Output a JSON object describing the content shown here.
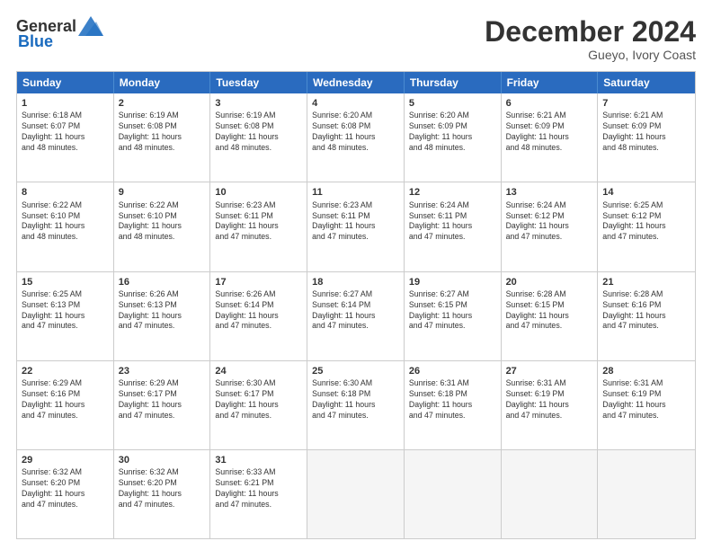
{
  "header": {
    "logo_general": "General",
    "logo_blue": "Blue",
    "month_title": "December 2024",
    "location": "Gueyo, Ivory Coast"
  },
  "days_of_week": [
    "Sunday",
    "Monday",
    "Tuesday",
    "Wednesday",
    "Thursday",
    "Friday",
    "Saturday"
  ],
  "weeks": [
    [
      {
        "day": "1",
        "lines": [
          "Sunrise: 6:18 AM",
          "Sunset: 6:07 PM",
          "Daylight: 11 hours",
          "and 48 minutes."
        ]
      },
      {
        "day": "2",
        "lines": [
          "Sunrise: 6:19 AM",
          "Sunset: 6:08 PM",
          "Daylight: 11 hours",
          "and 48 minutes."
        ]
      },
      {
        "day": "3",
        "lines": [
          "Sunrise: 6:19 AM",
          "Sunset: 6:08 PM",
          "Daylight: 11 hours",
          "and 48 minutes."
        ]
      },
      {
        "day": "4",
        "lines": [
          "Sunrise: 6:20 AM",
          "Sunset: 6:08 PM",
          "Daylight: 11 hours",
          "and 48 minutes."
        ]
      },
      {
        "day": "5",
        "lines": [
          "Sunrise: 6:20 AM",
          "Sunset: 6:09 PM",
          "Daylight: 11 hours",
          "and 48 minutes."
        ]
      },
      {
        "day": "6",
        "lines": [
          "Sunrise: 6:21 AM",
          "Sunset: 6:09 PM",
          "Daylight: 11 hours",
          "and 48 minutes."
        ]
      },
      {
        "day": "7",
        "lines": [
          "Sunrise: 6:21 AM",
          "Sunset: 6:09 PM",
          "Daylight: 11 hours",
          "and 48 minutes."
        ]
      }
    ],
    [
      {
        "day": "8",
        "lines": [
          "Sunrise: 6:22 AM",
          "Sunset: 6:10 PM",
          "Daylight: 11 hours",
          "and 48 minutes."
        ]
      },
      {
        "day": "9",
        "lines": [
          "Sunrise: 6:22 AM",
          "Sunset: 6:10 PM",
          "Daylight: 11 hours",
          "and 48 minutes."
        ]
      },
      {
        "day": "10",
        "lines": [
          "Sunrise: 6:23 AM",
          "Sunset: 6:11 PM",
          "Daylight: 11 hours",
          "and 47 minutes."
        ]
      },
      {
        "day": "11",
        "lines": [
          "Sunrise: 6:23 AM",
          "Sunset: 6:11 PM",
          "Daylight: 11 hours",
          "and 47 minutes."
        ]
      },
      {
        "day": "12",
        "lines": [
          "Sunrise: 6:24 AM",
          "Sunset: 6:11 PM",
          "Daylight: 11 hours",
          "and 47 minutes."
        ]
      },
      {
        "day": "13",
        "lines": [
          "Sunrise: 6:24 AM",
          "Sunset: 6:12 PM",
          "Daylight: 11 hours",
          "and 47 minutes."
        ]
      },
      {
        "day": "14",
        "lines": [
          "Sunrise: 6:25 AM",
          "Sunset: 6:12 PM",
          "Daylight: 11 hours",
          "and 47 minutes."
        ]
      }
    ],
    [
      {
        "day": "15",
        "lines": [
          "Sunrise: 6:25 AM",
          "Sunset: 6:13 PM",
          "Daylight: 11 hours",
          "and 47 minutes."
        ]
      },
      {
        "day": "16",
        "lines": [
          "Sunrise: 6:26 AM",
          "Sunset: 6:13 PM",
          "Daylight: 11 hours",
          "and 47 minutes."
        ]
      },
      {
        "day": "17",
        "lines": [
          "Sunrise: 6:26 AM",
          "Sunset: 6:14 PM",
          "Daylight: 11 hours",
          "and 47 minutes."
        ]
      },
      {
        "day": "18",
        "lines": [
          "Sunrise: 6:27 AM",
          "Sunset: 6:14 PM",
          "Daylight: 11 hours",
          "and 47 minutes."
        ]
      },
      {
        "day": "19",
        "lines": [
          "Sunrise: 6:27 AM",
          "Sunset: 6:15 PM",
          "Daylight: 11 hours",
          "and 47 minutes."
        ]
      },
      {
        "day": "20",
        "lines": [
          "Sunrise: 6:28 AM",
          "Sunset: 6:15 PM",
          "Daylight: 11 hours",
          "and 47 minutes."
        ]
      },
      {
        "day": "21",
        "lines": [
          "Sunrise: 6:28 AM",
          "Sunset: 6:16 PM",
          "Daylight: 11 hours",
          "and 47 minutes."
        ]
      }
    ],
    [
      {
        "day": "22",
        "lines": [
          "Sunrise: 6:29 AM",
          "Sunset: 6:16 PM",
          "Daylight: 11 hours",
          "and 47 minutes."
        ]
      },
      {
        "day": "23",
        "lines": [
          "Sunrise: 6:29 AM",
          "Sunset: 6:17 PM",
          "Daylight: 11 hours",
          "and 47 minutes."
        ]
      },
      {
        "day": "24",
        "lines": [
          "Sunrise: 6:30 AM",
          "Sunset: 6:17 PM",
          "Daylight: 11 hours",
          "and 47 minutes."
        ]
      },
      {
        "day": "25",
        "lines": [
          "Sunrise: 6:30 AM",
          "Sunset: 6:18 PM",
          "Daylight: 11 hours",
          "and 47 minutes."
        ]
      },
      {
        "day": "26",
        "lines": [
          "Sunrise: 6:31 AM",
          "Sunset: 6:18 PM",
          "Daylight: 11 hours",
          "and 47 minutes."
        ]
      },
      {
        "day": "27",
        "lines": [
          "Sunrise: 6:31 AM",
          "Sunset: 6:19 PM",
          "Daylight: 11 hours",
          "and 47 minutes."
        ]
      },
      {
        "day": "28",
        "lines": [
          "Sunrise: 6:31 AM",
          "Sunset: 6:19 PM",
          "Daylight: 11 hours",
          "and 47 minutes."
        ]
      }
    ],
    [
      {
        "day": "29",
        "lines": [
          "Sunrise: 6:32 AM",
          "Sunset: 6:20 PM",
          "Daylight: 11 hours",
          "and 47 minutes."
        ]
      },
      {
        "day": "30",
        "lines": [
          "Sunrise: 6:32 AM",
          "Sunset: 6:20 PM",
          "Daylight: 11 hours",
          "and 47 minutes."
        ]
      },
      {
        "day": "31",
        "lines": [
          "Sunrise: 6:33 AM",
          "Sunset: 6:21 PM",
          "Daylight: 11 hours",
          "and 47 minutes."
        ]
      },
      {
        "day": "",
        "lines": []
      },
      {
        "day": "",
        "lines": []
      },
      {
        "day": "",
        "lines": []
      },
      {
        "day": "",
        "lines": []
      }
    ]
  ]
}
